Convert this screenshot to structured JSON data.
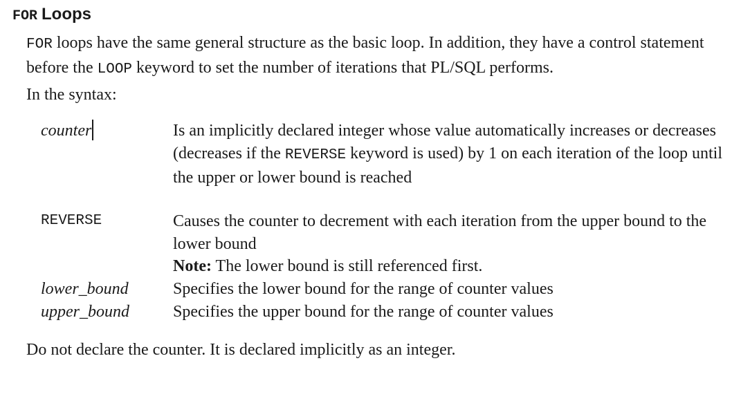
{
  "heading": {
    "keyword": "FOR",
    "title": "Loops"
  },
  "intro": {
    "part1": "FOR",
    "part2": " loops have the same general structure as the basic loop. In addition, they have a control statement before the ",
    "part3": "LOOP",
    "part4": " keyword to set the number of iterations that PL/SQL performs."
  },
  "syntax_label": "In the syntax:",
  "definitions": {
    "counter": {
      "term": "counter",
      "desc1": "Is an implicitly declared integer whose value automatically increases or decreases (decreases if the ",
      "desc_kw": "REVERSE",
      "desc2": " keyword is used) by 1 on each iteration of the loop until the upper or lower bound is reached"
    },
    "reverse": {
      "term": "REVERSE",
      "desc": "Causes the counter to decrement with each iteration from the upper bound to the lower bound",
      "note_label": "Note:",
      "note_text": " The lower bound is still referenced first."
    },
    "lower_bound": {
      "term": "lower_bound",
      "desc": "Specifies the lower bound for the range of counter values"
    },
    "upper_bound": {
      "term": "upper_bound",
      "desc": "Specifies the upper bound for the range of counter values"
    }
  },
  "closing": "Do not declare the counter. It is declared implicitly as an integer."
}
